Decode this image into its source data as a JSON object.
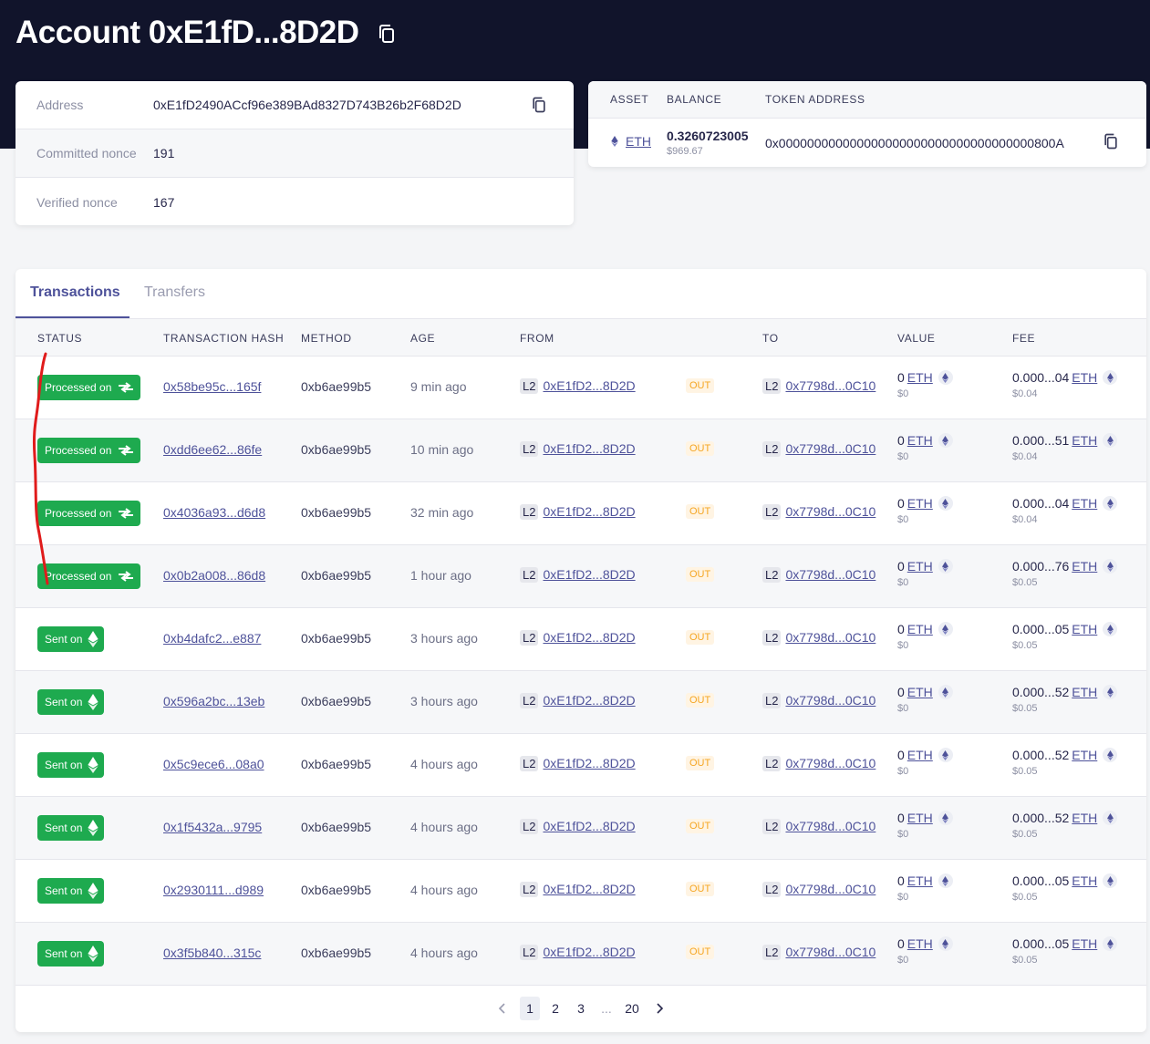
{
  "header": {
    "title": "Account 0xE1fD...8D2D"
  },
  "info": {
    "address_label": "Address",
    "address_value": "0xE1fD2490ACcf96e389BAd8327D743B26b2F68D2D",
    "committed_label": "Committed nonce",
    "committed_value": "191",
    "verified_label": "Verified nonce",
    "verified_value": "167"
  },
  "assets": {
    "headers": {
      "asset": "ASSET",
      "balance": "BALANCE",
      "token_address": "TOKEN ADDRESS"
    },
    "row": {
      "symbol": "ETH",
      "amount": "0.3260723005",
      "usd": "$969.67",
      "token_address": "0x000000000000000000000000000000000000800A"
    }
  },
  "tabs": {
    "transactions": "Transactions",
    "transfers": "Transfers"
  },
  "table": {
    "headers": {
      "status": "STATUS",
      "hash": "TRANSACTION HASH",
      "method": "METHOD",
      "age": "AGE",
      "from": "FROM",
      "to": "TO",
      "value": "VALUE",
      "fee": "FEE"
    },
    "layer_tag": "L2",
    "direction": "OUT",
    "rows": [
      {
        "status": "Processed on",
        "kind": "processed",
        "hash": "0x58be95c...165f",
        "method": "0xb6ae99b5",
        "age": "9 min ago",
        "from": "0xE1fD2...8D2D",
        "to": "0x7798d...0C10",
        "value": "0",
        "value_token": "ETH",
        "value_usd": "$0",
        "fee": "0.000...04",
        "fee_token": "ETH",
        "fee_usd": "$0.04"
      },
      {
        "status": "Processed on",
        "kind": "processed",
        "hash": "0xdd6ee62...86fe",
        "method": "0xb6ae99b5",
        "age": "10 min ago",
        "from": "0xE1fD2...8D2D",
        "to": "0x7798d...0C10",
        "value": "0",
        "value_token": "ETH",
        "value_usd": "$0",
        "fee": "0.000...51",
        "fee_token": "ETH",
        "fee_usd": "$0.04"
      },
      {
        "status": "Processed on",
        "kind": "processed",
        "hash": "0x4036a93...d6d8",
        "method": "0xb6ae99b5",
        "age": "32 min ago",
        "from": "0xE1fD2...8D2D",
        "to": "0x7798d...0C10",
        "value": "0",
        "value_token": "ETH",
        "value_usd": "$0",
        "fee": "0.000...04",
        "fee_token": "ETH",
        "fee_usd": "$0.04"
      },
      {
        "status": "Processed on",
        "kind": "processed",
        "hash": "0x0b2a008...86d8",
        "method": "0xb6ae99b5",
        "age": "1 hour ago",
        "from": "0xE1fD2...8D2D",
        "to": "0x7798d...0C10",
        "value": "0",
        "value_token": "ETH",
        "value_usd": "$0",
        "fee": "0.000...76",
        "fee_token": "ETH",
        "fee_usd": "$0.05"
      },
      {
        "status": "Sent on",
        "kind": "sent",
        "hash": "0xb4dafc2...e887",
        "method": "0xb6ae99b5",
        "age": "3 hours ago",
        "from": "0xE1fD2...8D2D",
        "to": "0x7798d...0C10",
        "value": "0",
        "value_token": "ETH",
        "value_usd": "$0",
        "fee": "0.000...05",
        "fee_token": "ETH",
        "fee_usd": "$0.05"
      },
      {
        "status": "Sent on",
        "kind": "sent",
        "hash": "0x596a2bc...13eb",
        "method": "0xb6ae99b5",
        "age": "3 hours ago",
        "from": "0xE1fD2...8D2D",
        "to": "0x7798d...0C10",
        "value": "0",
        "value_token": "ETH",
        "value_usd": "$0",
        "fee": "0.000...52",
        "fee_token": "ETH",
        "fee_usd": "$0.05"
      },
      {
        "status": "Sent on",
        "kind": "sent",
        "hash": "0x5c9ece6...08a0",
        "method": "0xb6ae99b5",
        "age": "4 hours ago",
        "from": "0xE1fD2...8D2D",
        "to": "0x7798d...0C10",
        "value": "0",
        "value_token": "ETH",
        "value_usd": "$0",
        "fee": "0.000...52",
        "fee_token": "ETH",
        "fee_usd": "$0.05"
      },
      {
        "status": "Sent on",
        "kind": "sent",
        "hash": "0x1f5432a...9795",
        "method": "0xb6ae99b5",
        "age": "4 hours ago",
        "from": "0xE1fD2...8D2D",
        "to": "0x7798d...0C10",
        "value": "0",
        "value_token": "ETH",
        "value_usd": "$0",
        "fee": "0.000...52",
        "fee_token": "ETH",
        "fee_usd": "$0.05"
      },
      {
        "status": "Sent on",
        "kind": "sent",
        "hash": "0x2930111...d989",
        "method": "0xb6ae99b5",
        "age": "4 hours ago",
        "from": "0xE1fD2...8D2D",
        "to": "0x7798d...0C10",
        "value": "0",
        "value_token": "ETH",
        "value_usd": "$0",
        "fee": "0.000...05",
        "fee_token": "ETH",
        "fee_usd": "$0.05"
      },
      {
        "status": "Sent on",
        "kind": "sent",
        "hash": "0x3f5b840...315c",
        "method": "0xb6ae99b5",
        "age": "4 hours ago",
        "from": "0xE1fD2...8D2D",
        "to": "0x7798d...0C10",
        "value": "0",
        "value_token": "ETH",
        "value_usd": "$0",
        "fee": "0.000...05",
        "fee_token": "ETH",
        "fee_usd": "$0.05"
      }
    ]
  },
  "pagination": {
    "pages": [
      "1",
      "2",
      "3",
      "...",
      "20"
    ],
    "current": "1"
  },
  "colors": {
    "hero": "#11142b",
    "status_green": "#1eaa4f",
    "link": "#4e529a",
    "out_badge": "#f5a623",
    "annotation_red": "#e01b1b"
  }
}
